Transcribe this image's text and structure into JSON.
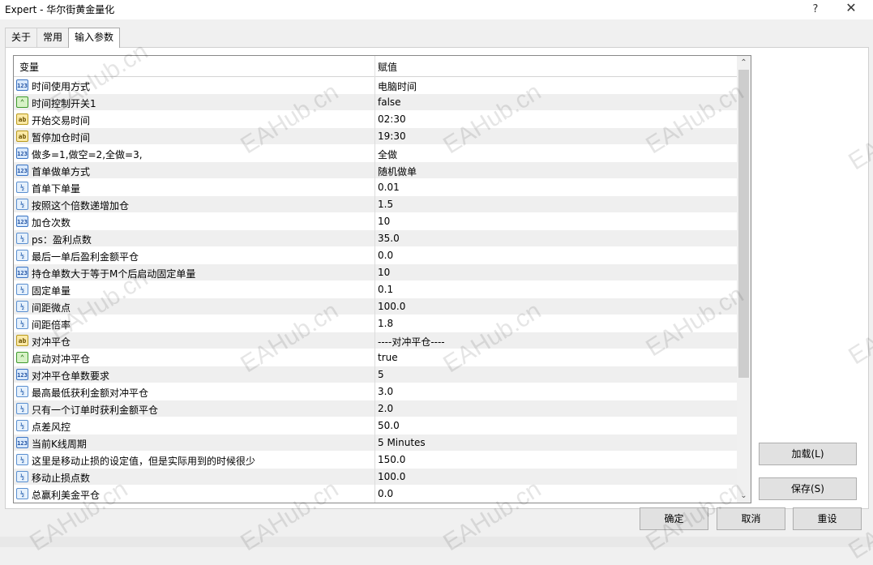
{
  "window": {
    "title": "Expert - 华尔街黄金量化",
    "help_glyph": "?",
    "close_glyph": "✕"
  },
  "tabs": [
    {
      "label": "关于"
    },
    {
      "label": "常用"
    },
    {
      "label": "输入参数"
    }
  ],
  "grid": {
    "columns": {
      "variable": "变量",
      "value": "赋值"
    },
    "rows": [
      {
        "icon": "int",
        "name": "时间使用方式",
        "value": "电脑时间"
      },
      {
        "icon": "bool",
        "name": "时间控制开关1",
        "value": "false"
      },
      {
        "icon": "str",
        "name": "开始交易时间",
        "value": "02:30"
      },
      {
        "icon": "str",
        "name": "暂停加仓时间",
        "value": "19:30"
      },
      {
        "icon": "int",
        "name": "做多=1,做空=2,全做=3,",
        "value": "全做"
      },
      {
        "icon": "int",
        "name": "首单做单方式",
        "value": "随机做单"
      },
      {
        "icon": "dbl",
        "name": "首单下单量",
        "value": "0.01"
      },
      {
        "icon": "dbl",
        "name": "按照这个倍数递增加仓",
        "value": "1.5"
      },
      {
        "icon": "int",
        "name": "加仓次数",
        "value": "10"
      },
      {
        "icon": "dbl",
        "name": "ps：盈利点数",
        "value": "35.0"
      },
      {
        "icon": "dbl",
        "name": "最后一单后盈利金额平仓",
        "value": "0.0"
      },
      {
        "icon": "int",
        "name": "持仓单数大于等于M个后启动固定单量",
        "value": "10"
      },
      {
        "icon": "dbl",
        "name": "固定单量",
        "value": "0.1"
      },
      {
        "icon": "dbl",
        "name": "间距微点",
        "value": "100.0"
      },
      {
        "icon": "dbl",
        "name": "间距倍率",
        "value": "1.8"
      },
      {
        "icon": "str",
        "name": "对冲平仓",
        "value": "----对冲平仓----"
      },
      {
        "icon": "bool",
        "name": "启动对冲平仓",
        "value": "true"
      },
      {
        "icon": "int",
        "name": "对冲平仓单数要求",
        "value": "5"
      },
      {
        "icon": "dbl",
        "name": "最高最低获利金额对冲平仓",
        "value": "3.0"
      },
      {
        "icon": "dbl",
        "name": "只有一个订单时获利金额平仓",
        "value": "2.0"
      },
      {
        "icon": "dbl",
        "name": "点差风控",
        "value": "50.0"
      },
      {
        "icon": "int",
        "name": "当前K线周期",
        "value": "5 Minutes"
      },
      {
        "icon": "dbl",
        "name": "这里是移动止损的设定值，但是实际用到的时候很少",
        "value": "150.0"
      },
      {
        "icon": "dbl",
        "name": "移动止损点数",
        "value": "100.0"
      },
      {
        "icon": "dbl",
        "name": "总赢利美金平仓",
        "value": "0.0"
      }
    ]
  },
  "icon_glyphs": {
    "int": "123",
    "dbl": "½",
    "str": "ab",
    "bool": "⌃"
  },
  "scroll": {
    "up": "⌃",
    "down": "⌄"
  },
  "buttons": {
    "load": "加载(L)",
    "save": "保存(S)",
    "ok": "确定",
    "cancel": "取消",
    "reset": "重设"
  },
  "watermark": "EAHub.cn"
}
